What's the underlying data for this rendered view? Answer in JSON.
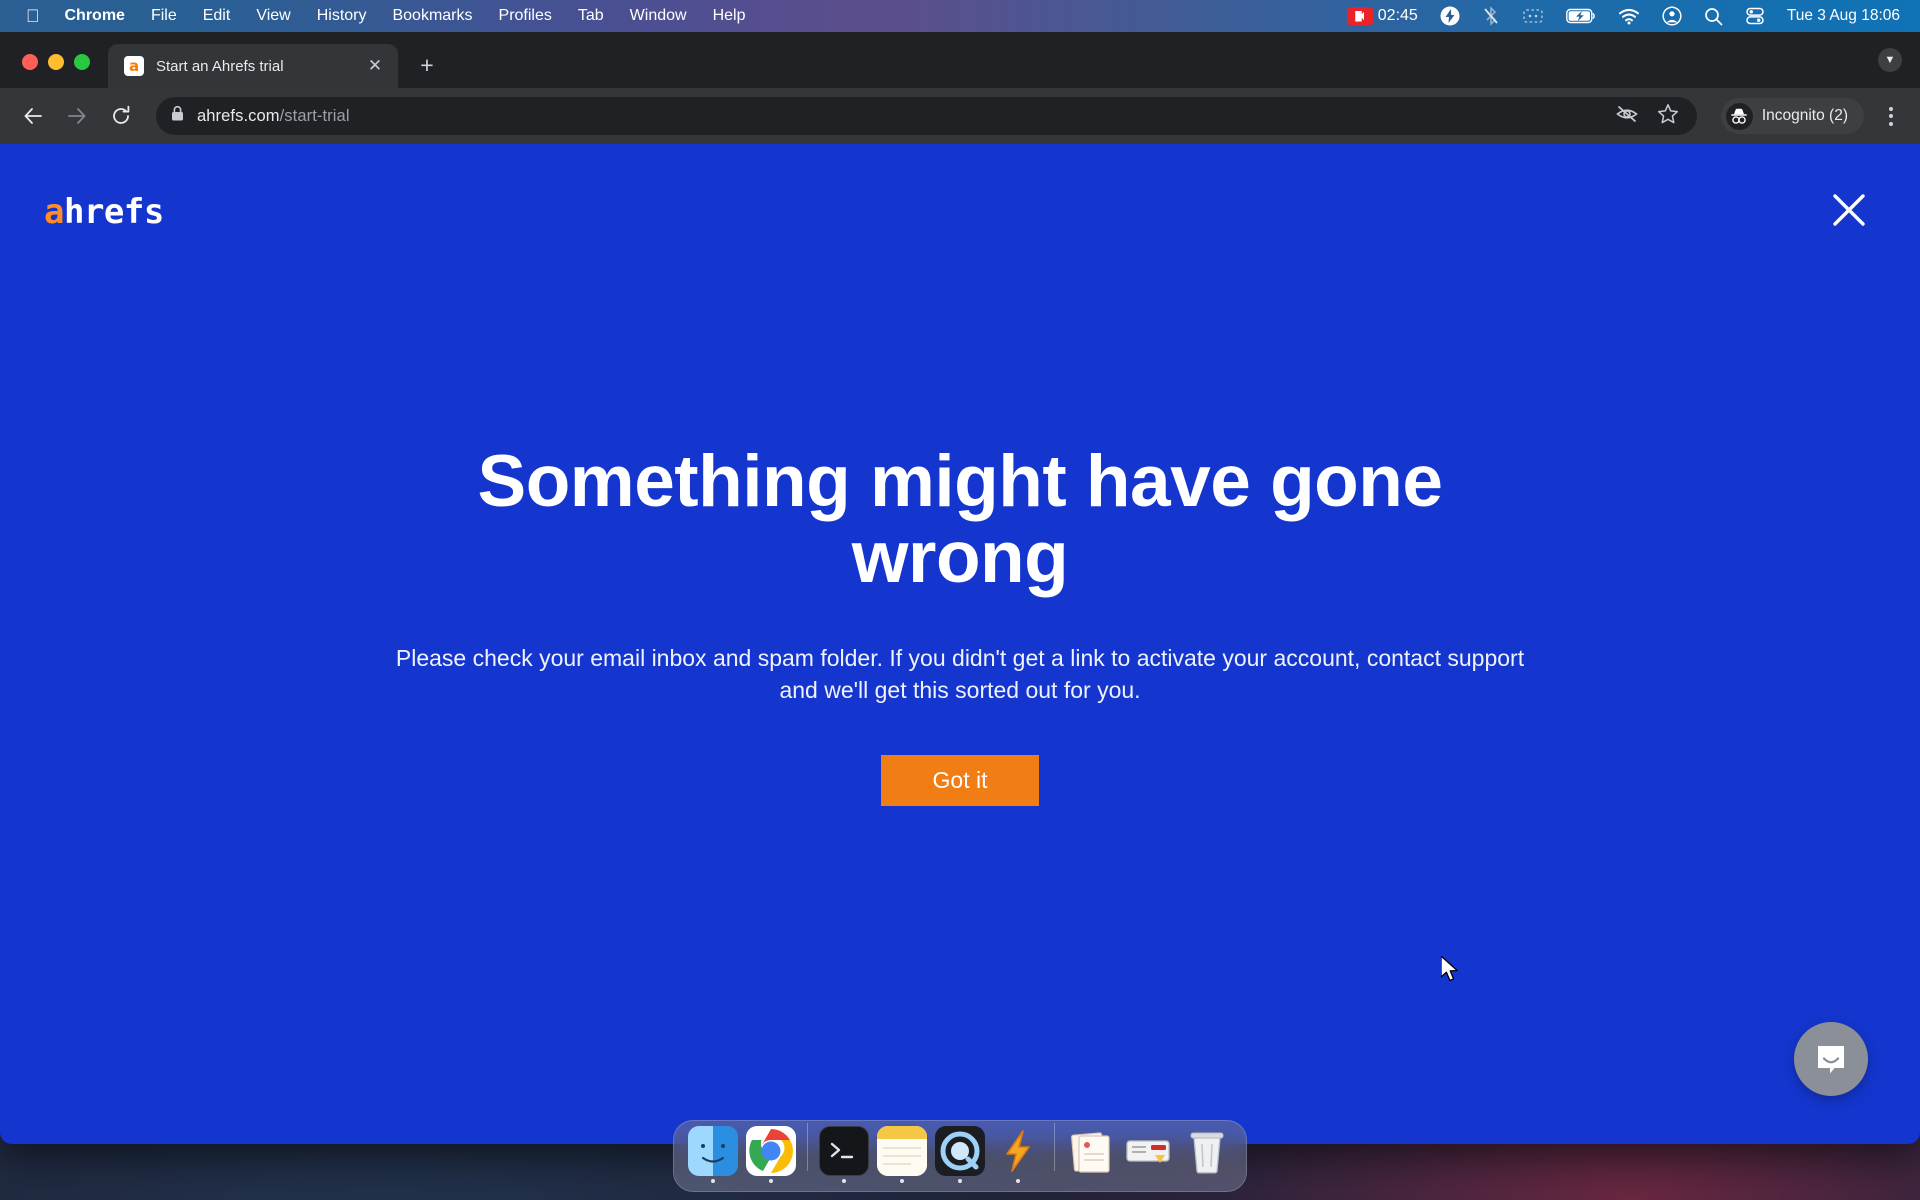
{
  "menubar": {
    "apple_icon": "apple-logo",
    "items": [
      {
        "label": "Chrome",
        "bold": true
      },
      {
        "label": "File",
        "bold": false
      },
      {
        "label": "Edit",
        "bold": false
      },
      {
        "label": "View",
        "bold": false
      },
      {
        "label": "History",
        "bold": false
      },
      {
        "label": "Bookmarks",
        "bold": false
      },
      {
        "label": "Profiles",
        "bold": false
      },
      {
        "label": "Tab",
        "bold": false
      },
      {
        "label": "Window",
        "bold": false
      },
      {
        "label": "Help",
        "bold": false
      }
    ],
    "status": {
      "recording_time": "02:45",
      "recording_icon": "screen-recording-icon",
      "bolt_icon": "bolt-icon",
      "bluetooth_icon": "bluetooth-off-icon",
      "display_icon": "display-icon",
      "battery_icon": "battery-charging-icon",
      "wifi_icon": "wifi-icon",
      "user_icon": "user-account-icon",
      "search_icon": "spotlight-search-icon",
      "control_center_icon": "control-center-icon",
      "datetime": "Tue 3 Aug  18:06"
    }
  },
  "browser": {
    "tab": {
      "title": "Start an Ahrefs trial",
      "favicon_letter": "a",
      "close_icon": "close-icon"
    },
    "new_tab_label": "+",
    "tabstrip_chevron": "chevron-down-icon",
    "toolbar": {
      "back_icon": "back-arrow-icon",
      "forward_icon": "forward-arrow-icon",
      "reload_icon": "reload-icon",
      "lock_icon": "lock-icon",
      "url_domain": "ahrefs.com",
      "url_path": "/start-trial",
      "eye_slash_icon": "eye-slash-icon",
      "bookmark_icon": "star-bookmark-icon",
      "profile_label": "Incognito (2)",
      "profile_icon": "incognito-avatar-icon",
      "menu_icon": "kebab-menu-icon"
    }
  },
  "page": {
    "logo_accent": "a",
    "logo_rest": "hrefs",
    "close_icon": "close-icon",
    "headline": "Something might have gone wrong",
    "subtext": "Please check your email inbox and spam folder. If you didn't get a link to activate your account, contact support and we'll get this sorted out for you.",
    "cta_label": "Got it",
    "chat_icon": "chat-bubble-icon",
    "colors": {
      "background": "#1436CE",
      "cta": "#F07E15",
      "logo_accent": "#ff8b29",
      "text": "#ffffff"
    }
  },
  "dock": {
    "items": [
      {
        "name": "finder",
        "running": true
      },
      {
        "name": "chrome",
        "running": true
      },
      {
        "name": "terminal",
        "running": true
      },
      {
        "name": "stickies",
        "running": true
      },
      {
        "name": "quicktime",
        "running": true
      },
      {
        "name": "bolt-app",
        "running": true
      },
      {
        "name": "documents-stack",
        "running": false
      },
      {
        "name": "ticket-tool",
        "running": false
      },
      {
        "name": "trash",
        "running": false
      }
    ]
  }
}
